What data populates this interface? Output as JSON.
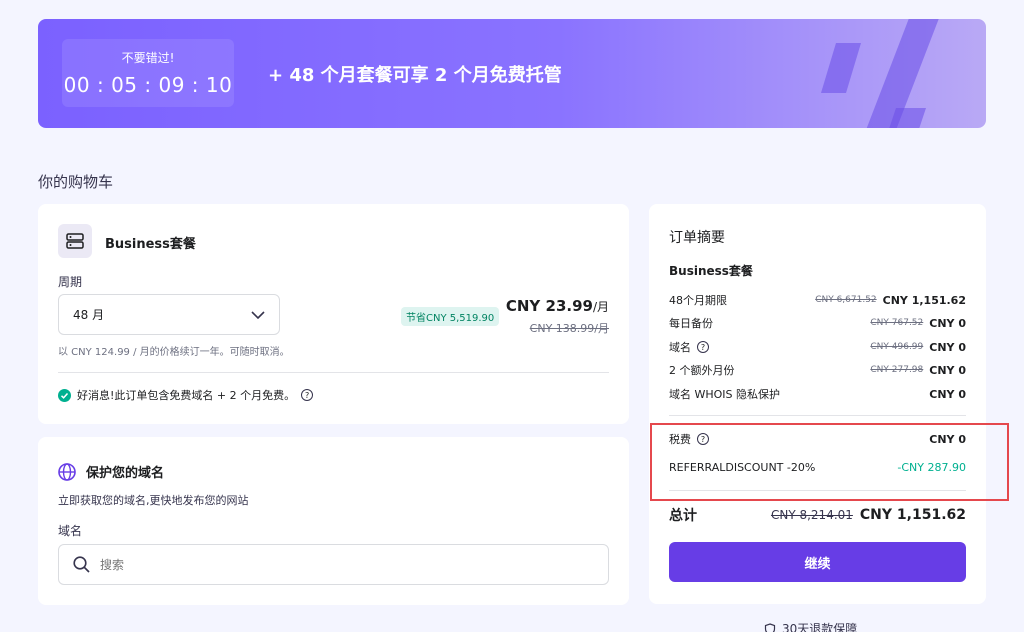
{
  "banner": {
    "timer_label": "不要错过!",
    "timer_value": "00 : 05 : 09 : 10",
    "promo_text": "+ 48 个月套餐可享 2 个月免费托管"
  },
  "cart": {
    "title": "你的购物车"
  },
  "product": {
    "name": "Business套餐",
    "period_label": "周期",
    "period_value": "48 月",
    "save_badge": "节省CNY 5,519.90",
    "price": "CNY 23.99",
    "price_unit": "/月",
    "old_price": "CNY 138.99/月",
    "renew_note": "以 CNY 124.99 / 月的价格续订一年。可随时取消。",
    "good_news": "好消息!此订单包含免费域名 + 2 个月免费。"
  },
  "domain": {
    "title": "保护您的域名",
    "subtitle": "立即获取您的域名,更快地发布您的网站",
    "field_label": "域名",
    "search_placeholder": "搜索"
  },
  "summary": {
    "title": "订单摘要",
    "plan": "Business套餐",
    "rows": [
      {
        "label": "48个月期限",
        "old": "CNY 6,671.52",
        "value": "CNY 1,151.62"
      },
      {
        "label": "每日备份",
        "old": "CNY 767.52",
        "value": "CNY 0"
      },
      {
        "label": "域名",
        "old": "CNY 496.99",
        "value": "CNY 0"
      },
      {
        "label": "2 个额外月份",
        "old": "CNY 277.98",
        "value": "CNY 0"
      },
      {
        "label": "域名 WHOIS 隐私保护",
        "old": "",
        "value": "CNY 0"
      }
    ],
    "tax_label": "税费",
    "tax_value": "CNY 0",
    "discount_label": "REFERRALDISCOUNT -20%",
    "discount_value": "-CNY 287.90",
    "total_label": "总计",
    "total_old": "CNY 8,214.01",
    "total_value": "CNY 1,151.62",
    "continue_label": "继续",
    "refund_text": "30天退款保障"
  },
  "colors": {
    "accent": "#673de6",
    "success": "#00b090",
    "highlight": "#e5484d"
  }
}
